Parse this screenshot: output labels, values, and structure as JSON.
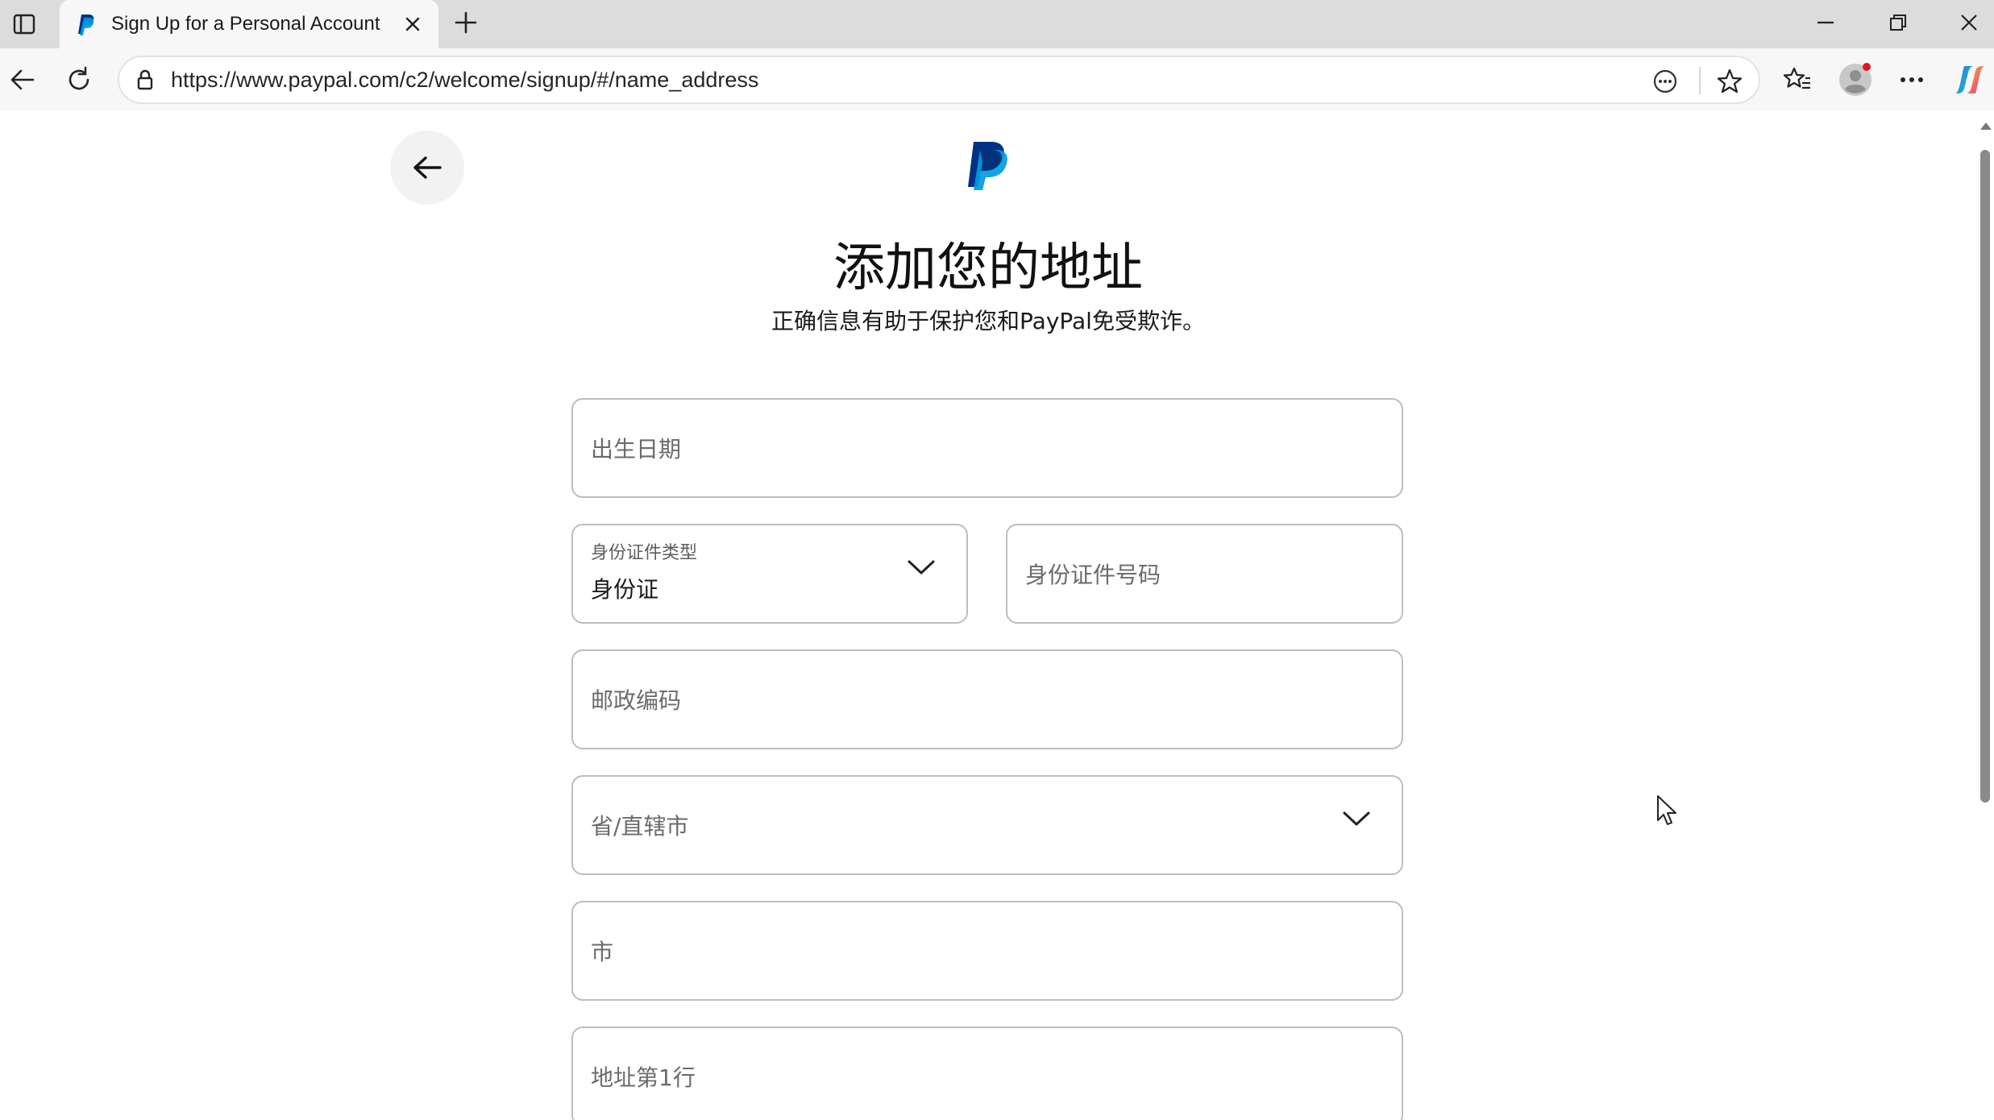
{
  "browser": {
    "tab_title": "Sign Up for a Personal Account | PayPal",
    "url": "https://www.paypal.com/c2/welcome/signup/#/name_address"
  },
  "page": {
    "heading": "添加您的地址",
    "subheading": "正确信息有助于保护您和PayPal免受欺诈。"
  },
  "form": {
    "dob_label": "出生日期",
    "id_type_label": "身份证件类型",
    "id_type_value": "身份证",
    "id_number_label": "身份证件号码",
    "postal_label": "邮政编码",
    "province_label": "省/直辖市",
    "city_label": "市",
    "address1_label": "地址第1行"
  },
  "colors": {
    "paypal_dark_blue": "#003087",
    "paypal_light_blue": "#009cde",
    "field_border": "#bdbdbd",
    "profile_badge": "#e81123"
  },
  "icons": {
    "tab_actions": "tab-actions-icon",
    "favicon": "paypal-favicon",
    "back": "back-arrow-icon",
    "refresh": "refresh-icon",
    "lock": "site-info-icon",
    "reader": "immersive-reader-icon",
    "favorite": "star-icon",
    "favorites": "favorites-icon",
    "profile": "profile-icon",
    "more": "more-icon",
    "copilot": "copilot-icon",
    "dropdown": "chevron-down-icon"
  }
}
